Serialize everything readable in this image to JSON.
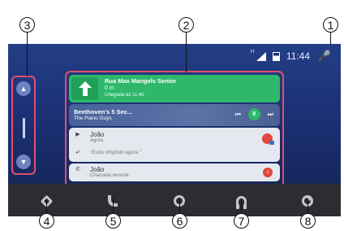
{
  "callouts": [
    "1",
    "2",
    "3",
    "4",
    "5",
    "6",
    "7",
    "8"
  ],
  "status_bar": {
    "time": "11:44",
    "signal_tag": "H",
    "icons": [
      "signal-icon",
      "battery-icon",
      "mic-icon"
    ]
  },
  "rail": {
    "up_icon": "chevron-up-icon",
    "down_icon": "chevron-down-icon"
  },
  "navigation_card": {
    "street": "Rua Max Mangels Senior",
    "distance": "0 m",
    "arrival": "Chegada às 11:40",
    "turn_icon": "arrow-up-icon",
    "color": "#2fb86c"
  },
  "music_card": {
    "title": "Beethoven's 5 Sec...",
    "artist": "The Piano Guys",
    "prev_icon": "previous-track-icon",
    "play_icon": "pause-icon",
    "next_icon": "next-track-icon"
  },
  "message_card": {
    "name": "João",
    "time": "Agora",
    "message": "\"Estou dirigindo agora.\"",
    "play_icon": "play-icon",
    "reply_icon": "reply-icon"
  },
  "call_card": {
    "name": "João",
    "status": "Chamada recente",
    "phone_icon": "phone-icon"
  },
  "bottom_bar": {
    "items": [
      "navigation-icon",
      "phone-icon",
      "home-icon",
      "headphones-icon",
      "exit-icon"
    ]
  },
  "colors": {
    "accent": "#e0506a",
    "background": "#1c3176",
    "bar": "#2c2d33"
  }
}
